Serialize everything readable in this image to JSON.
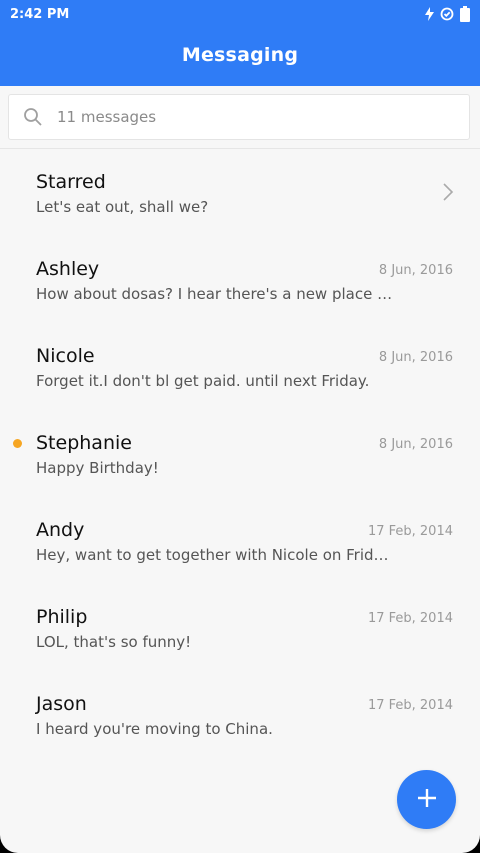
{
  "status_bar": {
    "time": "2:42 PM",
    "icons": [
      "charging-bolt-icon",
      "sync-icon",
      "battery-icon"
    ]
  },
  "app_bar": {
    "title": "Messaging",
    "color": "#2f7cf6"
  },
  "search": {
    "placeholder": "11 messages",
    "icon": "search-icon"
  },
  "conversations": [
    {
      "name": "Starred",
      "preview": "Let's eat out, shall we?",
      "date": "",
      "has_chevron": true,
      "unread": false
    },
    {
      "name": "Ashley",
      "preview": "How about dosas? I hear there's a new place do…",
      "date": "8 Jun, 2016",
      "unread": false
    },
    {
      "name": "Nicole",
      "preview": "Forget it.I don't bl get paid. until next Friday.",
      "date": "8 Jun, 2016",
      "unread": false
    },
    {
      "name": "Stephanie",
      "preview": "Happy Birthday!",
      "date": "8 Jun, 2016",
      "unread": true
    },
    {
      "name": "Andy",
      "preview": "Hey, want to get together with Nicole on Friday?",
      "date": "17 Feb, 2014",
      "unread": false
    },
    {
      "name": "Philip",
      "preview": "LOL, that's so funny!",
      "date": "17 Feb, 2014",
      "unread": false
    },
    {
      "name": "Jason",
      "preview": "I heard you're moving to China.",
      "date": "17 Feb, 2014",
      "unread": false
    }
  ],
  "fab": {
    "icon": "plus-icon",
    "color": "#2f7cf6"
  },
  "unread_color": "#f6a623"
}
